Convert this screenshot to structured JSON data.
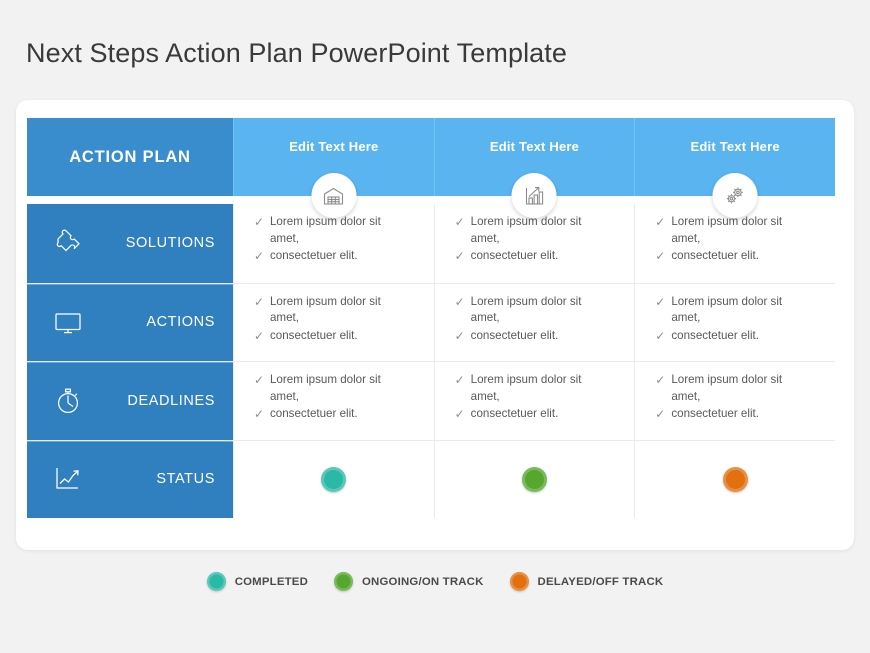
{
  "page": {
    "title": "Next Steps Action Plan PowerPoint Template",
    "background_color": "#f2f2f2"
  },
  "colors": {
    "header_main": "#3a8dcc",
    "header_column": "#59b4ef",
    "sidebar": "#3080c0",
    "status_completed": "#2bb9a7",
    "status_ongoing": "#57a72f",
    "status_delayed": "#e2700f",
    "text_body": "#58595b",
    "check_mark": "#8d8d8d"
  },
  "table": {
    "header": {
      "main_label": "ACTION PLAN",
      "columns": [
        {
          "label": "Edit Text Here",
          "icon": "warehouse-icon"
        },
        {
          "label": "Edit Text Here",
          "icon": "bar-chart-arrow-icon"
        },
        {
          "label": "Edit Text Here",
          "icon": "gears-icon"
        }
      ]
    },
    "rows": [
      {
        "label": "SOLUTIONS",
        "icon": "puzzle-piece-icon",
        "type": "text",
        "cells": [
          [
            "Lorem ipsum dolor sit amet,",
            "consectetuer elit."
          ],
          [
            "Lorem ipsum dolor sit amet,",
            "consectetuer elit."
          ],
          [
            "Lorem ipsum dolor sit amet,",
            "consectetuer elit."
          ]
        ]
      },
      {
        "label": "ACTIONS",
        "icon": "monitor-icon",
        "type": "text",
        "cells": [
          [
            "Lorem ipsum dolor sit amet,",
            "consectetuer elit."
          ],
          [
            "Lorem ipsum dolor sit amet,",
            "consectetuer elit."
          ],
          [
            "Lorem ipsum dolor sit amet,",
            "consectetuer elit."
          ]
        ]
      },
      {
        "label": "DEADLINES",
        "icon": "stopwatch-icon",
        "type": "text",
        "cells": [
          [
            "Lorem ipsum dolor sit amet,",
            "consectetuer elit."
          ],
          [
            "Lorem ipsum dolor sit amet,",
            "consectetuer elit."
          ],
          [
            "Lorem ipsum dolor sit amet,",
            "consectetuer elit."
          ]
        ]
      },
      {
        "label": "STATUS",
        "icon": "line-chart-icon",
        "type": "status",
        "statuses": [
          {
            "state": "COMPLETED",
            "color": "#2bb9a7"
          },
          {
            "state": "ONGOING/ON TRACK",
            "color": "#57a72f"
          },
          {
            "state": "DELAYED/OFF TRACK",
            "color": "#e2700f"
          }
        ]
      }
    ]
  },
  "legend": {
    "items": [
      {
        "label": "COMPLETED",
        "color": "#2bb9a7"
      },
      {
        "label": "ONGOING/ON TRACK",
        "color": "#57a72f"
      },
      {
        "label": "DELAYED/OFF TRACK",
        "color": "#e2700f"
      }
    ]
  },
  "check_glyph": "✓"
}
